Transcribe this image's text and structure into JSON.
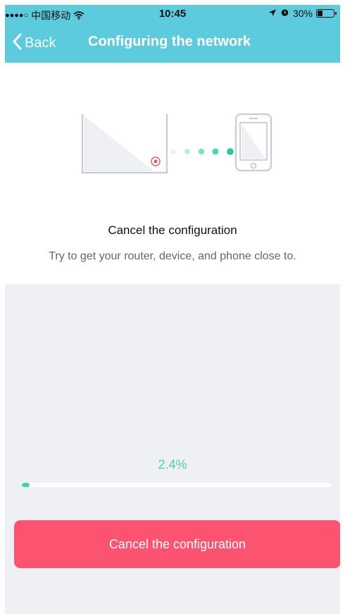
{
  "status_bar": {
    "signal": "●●●●○",
    "carrier": "中国移动",
    "time": "10:45",
    "battery": "30%",
    "battery_level": 0.3
  },
  "nav": {
    "back_label": "Back",
    "title": "Configuring the network"
  },
  "main": {
    "status_title": "Cancel the configuration",
    "status_subtitle": "Try to get your router, device, and phone close to."
  },
  "progress": {
    "label": "2.4%",
    "value": 0.024
  },
  "actions": {
    "cancel_label": "Cancel the configuration"
  },
  "colors": {
    "header": "#5ccbdd",
    "progress": "#3fd4b1",
    "progress_text": "#4fcdb0",
    "cancel_button": "#fc5470",
    "panel": "#eef0f3"
  },
  "icons": {
    "back": "chevron-left-icon",
    "wifi": "wifi-icon",
    "location": "location-arrow-icon",
    "alarm": "alarm-icon",
    "battery": "battery-icon"
  }
}
